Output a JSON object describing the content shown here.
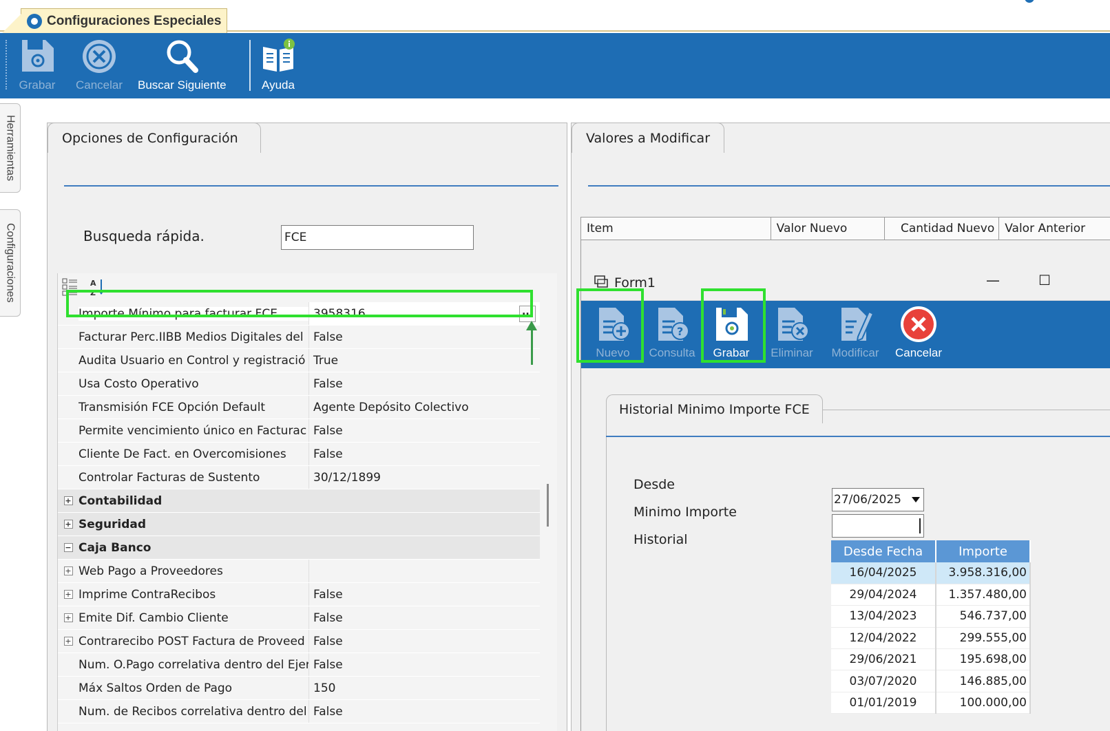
{
  "doc_tab": {
    "title": "Configuraciones Especiales"
  },
  "toolbar": {
    "grabar": "Grabar",
    "cancelar": "Cancelar",
    "buscar_siguiente": "Buscar Siguiente",
    "ayuda": "Ayuda"
  },
  "side_tabs": {
    "herramientas": "Herramientas",
    "configuraciones": "Configuraciones"
  },
  "left_panel": {
    "tab": "Opciones de Configuración",
    "quick_search_label": "Busqueda rápida.",
    "quick_search_value": "FCE",
    "rows": [
      {
        "name": "Importe Mínimo para facturar FCE",
        "value": "3958316",
        "type": "sel"
      },
      {
        "name": "Facturar Perc.IIBB Medios Digitales del",
        "value": "False",
        "type": "item"
      },
      {
        "name": "Audita Usuario en Control y registració",
        "value": "True",
        "type": "item"
      },
      {
        "name": "Usa Costo Operativo",
        "value": "False",
        "type": "item"
      },
      {
        "name": "Transmisión FCE Opción Default",
        "value": "Agente Depósito Colectivo",
        "type": "item"
      },
      {
        "name": "Permite vencimiento único en Facturac",
        "value": "False",
        "type": "item"
      },
      {
        "name": "Cliente De Fact. en Overcomisiones",
        "value": "False",
        "type": "item"
      },
      {
        "name": "Controlar Facturas de Sustento",
        "value": "30/12/1899",
        "type": "item"
      },
      {
        "name": "Contabilidad",
        "value": "",
        "type": "cat",
        "expander": "+"
      },
      {
        "name": "Seguridad",
        "value": "",
        "type": "cat",
        "expander": "+"
      },
      {
        "name": "Caja Banco",
        "value": "",
        "type": "cat",
        "expander": "−"
      },
      {
        "name": "Web Pago a Proveedores",
        "value": "",
        "type": "sub",
        "expander": "+"
      },
      {
        "name": "Imprime ContraRecibos",
        "value": "False",
        "type": "sub",
        "expander": "+"
      },
      {
        "name": "Emite Dif. Cambio Cliente",
        "value": "False",
        "type": "sub",
        "expander": "+"
      },
      {
        "name": "Contrarecibo POST Factura de Proveed",
        "value": "False",
        "type": "sub",
        "expander": "+"
      },
      {
        "name": "Num. O.Pago correlativa dentro del Ejer",
        "value": "False",
        "type": "item"
      },
      {
        "name": "Máx Saltos Orden de Pago",
        "value": "150",
        "type": "item"
      },
      {
        "name": "Num. de Recibos correlativa dentro del",
        "value": "False",
        "type": "item"
      }
    ],
    "ellipsis": "..."
  },
  "right_panel": {
    "tab": "Valores a Modificar",
    "columns": [
      "Item",
      "Valor Nuevo",
      "Cantidad Nuevo",
      "Valor Anterior"
    ]
  },
  "form1": {
    "title": "Form1",
    "minimize": "—",
    "maximize": "☐",
    "toolbar": {
      "nuevo": "Nuevo",
      "consulta": "Consulta",
      "grabar": "Grabar",
      "eliminar": "Eliminar",
      "modificar": "Modificar",
      "cancelar": "Cancelar"
    },
    "tab": "Historial Minimo Importe FCE",
    "desde_label": "Desde",
    "desde_value": "27/06/2025",
    "minimo_label": "Minimo Importe",
    "minimo_value": "",
    "historial_label": "Historial",
    "history_columns": [
      "Desde Fecha",
      "Importe"
    ],
    "history": [
      {
        "fecha": "16/04/2025",
        "importe": "3.958.316,00"
      },
      {
        "fecha": "29/04/2024",
        "importe": "1.357.480,00"
      },
      {
        "fecha": "13/04/2023",
        "importe": "546.737,00"
      },
      {
        "fecha": "12/04/2022",
        "importe": "299.555,00"
      },
      {
        "fecha": "29/06/2021",
        "importe": "195.698,00"
      },
      {
        "fecha": "03/07/2020",
        "importe": "146.885,00"
      },
      {
        "fecha": "01/01/2019",
        "importe": "100.000,00"
      }
    ]
  },
  "colors": {
    "toolbar_blue": "#1e6db4",
    "highlight_green": "#2fe02f",
    "table_header_blue": "#5b97d5",
    "selected_row": "#cfe8f8"
  }
}
